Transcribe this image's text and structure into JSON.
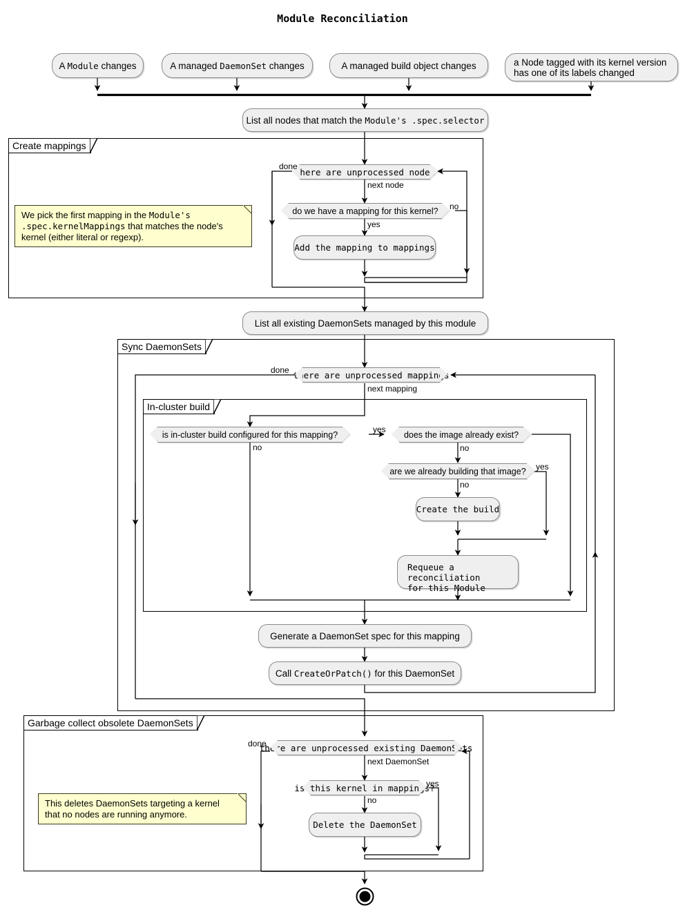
{
  "title": "Module Reconciliation",
  "colors": {
    "node_fill": "#EFEFEF",
    "node_border": "#8A8A8A",
    "note_fill": "#FEFECE",
    "note_border": "#3A3A1F",
    "line": "#000000",
    "background": "#FFFFFF"
  },
  "start_nodes": [
    {
      "id": "start-module-changes",
      "label": "A Module changes",
      "parts": [
        {
          "t": "A ",
          "mono": false
        },
        {
          "t": "Module",
          "mono": true
        },
        {
          "t": " changes",
          "mono": false
        }
      ]
    },
    {
      "id": "start-daemonset-changes",
      "label": "A managed DaemonSet changes",
      "parts": [
        {
          "t": "A managed ",
          "mono": false
        },
        {
          "t": "DaemonSet",
          "mono": true
        },
        {
          "t": " changes",
          "mono": false
        }
      ]
    },
    {
      "id": "start-build-object-changes",
      "label": "A managed build object changes",
      "parts": [
        {
          "t": "A managed build object changes",
          "mono": false
        }
      ]
    },
    {
      "id": "start-node-label-changed",
      "label": "a Node tagged with its kernel version has one of its labels changed",
      "lines": [
        "a Node tagged with its kernel version",
        "has one of its labels changed"
      ]
    }
  ],
  "activities": {
    "list_nodes": {
      "label": "List all nodes that match the Module's .spec.selector",
      "parts": [
        {
          "t": "List all nodes that match the ",
          "mono": false
        },
        {
          "t": "Module's .spec.selector",
          "mono": true
        }
      ]
    },
    "add_mapping": {
      "label": "Add the mapping to mappings",
      "parts": [
        {
          "t": "Add the mapping to mappings",
          "mono": true
        }
      ]
    },
    "list_daemonsets": {
      "label": "List all existing DaemonSets managed by this module",
      "parts": [
        {
          "t": "List all existing DaemonSets managed by this module",
          "mono": false
        }
      ]
    },
    "create_build": {
      "label": "Create the build",
      "parts": [
        {
          "t": "Create the build",
          "mono": true
        }
      ]
    },
    "requeue": {
      "label": "Requeue a reconciliation for this Module",
      "lines": [
        [
          {
            "t": "Requeue a reconciliation",
            "mono": true
          }
        ],
        [
          {
            "t": "for this ",
            "mono": true
          },
          {
            "t": "Module",
            "mono": true
          }
        ]
      ]
    },
    "generate_spec": {
      "label": "Generate a DaemonSet spec for this mapping",
      "parts": [
        {
          "t": "Generate a DaemonSet spec for this mapping",
          "mono": false
        }
      ]
    },
    "create_or_patch": {
      "label": "Call CreateOrPatch() for this DaemonSet",
      "parts": [
        {
          "t": "Call ",
          "mono": false
        },
        {
          "t": "CreateOrPatch()",
          "mono": true
        },
        {
          "t": " for this DaemonSet",
          "mono": false
        }
      ]
    },
    "delete_daemonset": {
      "label": "Delete the DaemonSet",
      "parts": [
        {
          "t": "Delete the DaemonSet",
          "mono": true
        }
      ]
    }
  },
  "decisions": {
    "unprocessed_nodes": {
      "label": "there are unprocessed nodes",
      "mono": true,
      "branch_true": "next node",
      "branch_false": "done"
    },
    "have_mapping": {
      "label": "do we have a mapping for this kernel?",
      "mono": false,
      "branch_true": "yes",
      "branch_false": "no"
    },
    "unprocessed_mappings": {
      "label": "there are unprocessed mappings",
      "mono": true,
      "branch_true": "next mapping",
      "branch_false": "done"
    },
    "in_cluster_build_configured": {
      "label": "is in-cluster build configured for this mapping?",
      "mono": false,
      "branch_true": "yes",
      "branch_false": "no"
    },
    "image_exists": {
      "label": "does the image already exist?",
      "mono": false,
      "branch_true": "",
      "branch_false": "no"
    },
    "already_building": {
      "label": "are we already building that image?",
      "mono": false,
      "branch_true": "yes",
      "branch_false": "no"
    },
    "unprocessed_existing_daemonsets": {
      "label": "there are unprocessed existing DaemonSets",
      "mono": true,
      "branch_true": "next DaemonSet",
      "branch_false": "done"
    },
    "kernel_in_mappings": {
      "label": "is this kernel in mappings?",
      "mono": true,
      "branch_true": "yes",
      "branch_false": "no"
    }
  },
  "groups": {
    "create_mappings": {
      "title": "Create mappings"
    },
    "sync_daemonsets": {
      "title": "Sync DaemonSets"
    },
    "in_cluster_build": {
      "title": "In-cluster build"
    },
    "garbage_collect": {
      "title": "Garbage collect obsolete DaemonSets"
    }
  },
  "notes": {
    "mapping_note": {
      "text": "We pick the first mapping in the Module's .spec.kernelMappings that matches the node's kernel (either literal or regexp).",
      "lines": [
        [
          {
            "t": "We pick the first mapping in the ",
            "mono": false
          },
          {
            "t": "Module's",
            "mono": true
          }
        ],
        [
          {
            "t": ".spec.kernelMappings",
            "mono": true
          },
          {
            "t": " that matches the node's",
            "mono": false
          }
        ],
        [
          {
            "t": "kernel (either literal or regexp).",
            "mono": false
          }
        ]
      ]
    },
    "gc_note": {
      "text": "This deletes DaemonSets targeting a kernel that no nodes are running anymore.",
      "lines": [
        [
          {
            "t": "This deletes DaemonSets targeting a kernel",
            "mono": false
          }
        ],
        [
          {
            "t": "that no nodes are running anymore.",
            "mono": false
          }
        ]
      ]
    }
  },
  "edge_labels": {
    "done_1": "done",
    "next_node": "next node",
    "yes_1": "yes",
    "no_1": "no",
    "done_2": "done",
    "next_mapping": "next mapping",
    "yes_build": "yes",
    "no_build": "no",
    "no_image": "no",
    "yes_building": "yes",
    "no_building": "no",
    "done_3": "done",
    "next_daemonset": "next DaemonSet",
    "yes_kernel": "yes",
    "no_kernel": "no"
  },
  "end_node": {
    "name": "final-node"
  }
}
